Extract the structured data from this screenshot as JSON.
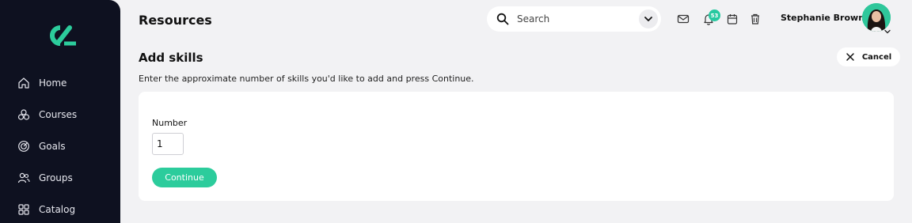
{
  "sidebar": {
    "logo": "brand-logo",
    "items": [
      {
        "label": "Home",
        "icon": "home-icon"
      },
      {
        "label": "Courses",
        "icon": "courses-icon"
      },
      {
        "label": "Goals",
        "icon": "goals-icon"
      },
      {
        "label": "Groups",
        "icon": "groups-icon"
      },
      {
        "label": "Catalog",
        "icon": "catalog-icon"
      }
    ]
  },
  "header": {
    "title": "Resources",
    "search": {
      "placeholder": "Search",
      "value": ""
    },
    "notifications_count": "53",
    "user_name": "Stephanie Brown"
  },
  "main": {
    "heading": "Add skills",
    "cancel_label": "Cancel",
    "instructions": "Enter the approximate number of skills you'd like to add and press Continue.",
    "form": {
      "number_label": "Number",
      "number_value": "1",
      "continue_label": "Continue"
    }
  },
  "colors": {
    "accent": "#2ccc9c",
    "sidebar_bg": "#0e1120",
    "page_bg": "#f2f2f4"
  }
}
